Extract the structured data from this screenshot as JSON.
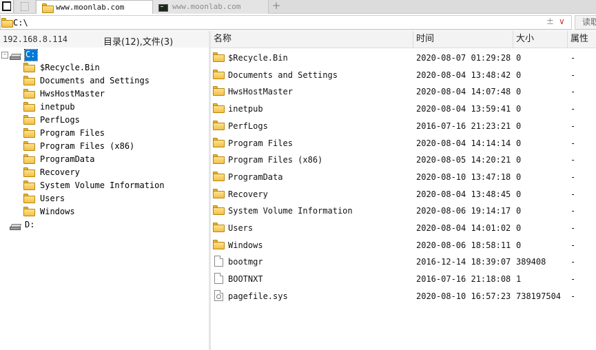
{
  "tabs": [
    {
      "label": "www.moonlab.com",
      "active": true,
      "icon": "folder-icon"
    },
    {
      "label": "www.moonlab.com",
      "active": false,
      "icon": "terminal-icon"
    }
  ],
  "new_tab_label": "+",
  "address": {
    "path": "C:\\",
    "read_button": "读取"
  },
  "info": {
    "ip": "192.168.8.114",
    "counts": "目录(12),文件(3)"
  },
  "tree": {
    "drive_c": "C:",
    "drive_d": "D:",
    "expand_symbol": "-",
    "folders": [
      "$Recycle.Bin",
      "Documents and Settings",
      "HwsHostMaster",
      "inetpub",
      "PerfLogs",
      "Program Files",
      "Program Files (x86)",
      "ProgramData",
      "Recovery",
      "System Volume Information",
      "Users",
      "Windows"
    ]
  },
  "columns": {
    "name": "名称",
    "time": "时间",
    "size": "大小",
    "attr": "属性"
  },
  "files": [
    {
      "name": "$Recycle.Bin",
      "time": "2020-08-07 01:29:28",
      "size": "0",
      "attr": "-",
      "type": "folder"
    },
    {
      "name": "Documents and Settings",
      "time": "2020-08-04 13:48:42",
      "size": "0",
      "attr": "-",
      "type": "folder"
    },
    {
      "name": "HwsHostMaster",
      "time": "2020-08-04 14:07:48",
      "size": "0",
      "attr": "-",
      "type": "folder"
    },
    {
      "name": "inetpub",
      "time": "2020-08-04 13:59:41",
      "size": "0",
      "attr": "-",
      "type": "folder"
    },
    {
      "name": "PerfLogs",
      "time": "2016-07-16 21:23:21",
      "size": "0",
      "attr": "-",
      "type": "folder"
    },
    {
      "name": "Program Files",
      "time": "2020-08-04 14:14:14",
      "size": "0",
      "attr": "-",
      "type": "folder"
    },
    {
      "name": "Program Files (x86)",
      "time": "2020-08-05 14:20:21",
      "size": "0",
      "attr": "-",
      "type": "folder"
    },
    {
      "name": "ProgramData",
      "time": "2020-08-10 13:47:18",
      "size": "0",
      "attr": "-",
      "type": "folder"
    },
    {
      "name": "Recovery",
      "time": "2020-08-04 13:48:45",
      "size": "0",
      "attr": "-",
      "type": "folder"
    },
    {
      "name": "System Volume Information",
      "time": "2020-08-06 19:14:17",
      "size": "0",
      "attr": "-",
      "type": "folder"
    },
    {
      "name": "Users",
      "time": "2020-08-04 14:01:02",
      "size": "0",
      "attr": "-",
      "type": "folder"
    },
    {
      "name": "Windows",
      "time": "2020-08-06 18:58:11",
      "size": "0",
      "attr": "-",
      "type": "folder"
    },
    {
      "name": "bootmgr",
      "time": "2016-12-14 18:39:07",
      "size": "389408",
      "attr": "-",
      "type": "file"
    },
    {
      "name": "BOOTNXT",
      "time": "2016-07-16 21:18:08",
      "size": "1",
      "attr": "-",
      "type": "file"
    },
    {
      "name": "pagefile.sys",
      "time": "2020-08-10 16:57:23",
      "size": "738197504",
      "attr": "-",
      "type": "sysfile"
    }
  ],
  "colors": {
    "selection": "#0078d7",
    "folder": "#f2c04a",
    "dropdown_arrow": "#d0322f"
  }
}
